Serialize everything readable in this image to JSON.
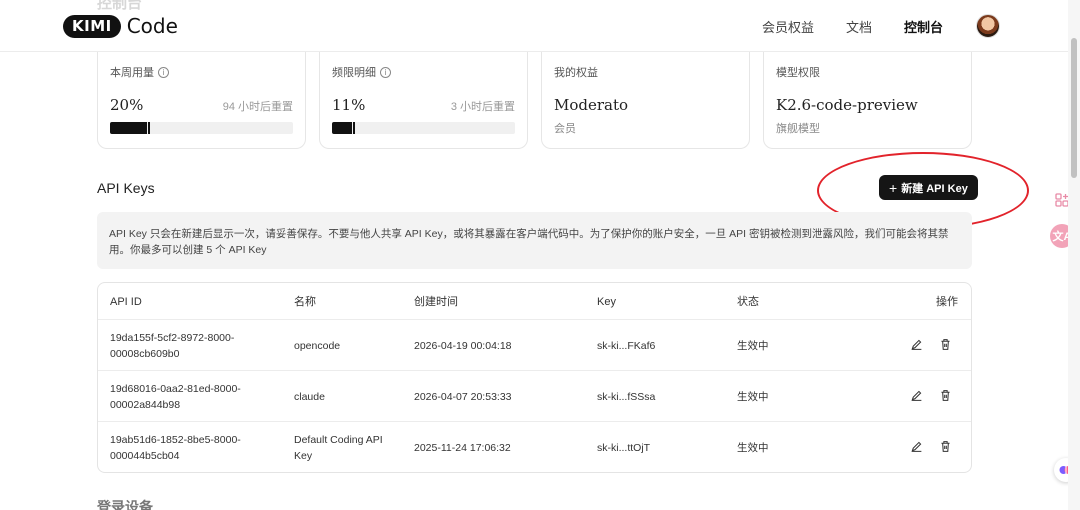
{
  "header": {
    "logo_badge": "KIMI",
    "logo_text": "Code",
    "nav": [
      "会员权益",
      "文档",
      "控制台"
    ],
    "active_nav": "控制台",
    "ghost_title": "控制台"
  },
  "cards": [
    {
      "label": "本周用量",
      "value": "20%",
      "reset": "94 小时后重置",
      "progress": 0.2
    },
    {
      "label": "频限明细",
      "value": "11%",
      "reset": "3 小时后重置",
      "progress": 0.11
    },
    {
      "label": "我的权益",
      "value": "Moderato",
      "sub": "会员"
    },
    {
      "label": "模型权限",
      "value": "K2.6-code-preview",
      "sub": "旗舰模型"
    }
  ],
  "api_keys": {
    "title": "API Keys",
    "new_button": "新建 API Key",
    "notice": "API Key 只会在新建后显示一次，请妥善保存。不要与他人共享 API Key，或将其暴露在客户端代码中。为了保护你的账户安全，一旦 API 密钥被检测到泄露风险，我们可能会将其禁用。你最多可以创建 5 个 API Key",
    "columns": [
      "API ID",
      "名称",
      "创建时间",
      "Key",
      "状态",
      "操作"
    ],
    "rows": [
      {
        "id": "19da155f-5cf2-8972-8000-00008cb609b0",
        "name": "opencode",
        "created": "2026-04-19 00:04:18",
        "key": "sk-ki...FKaf6",
        "status": "生效中"
      },
      {
        "id": "19d68016-0aa2-81ed-8000-00002a844b98",
        "name": "claude",
        "created": "2026-04-07 20:53:33",
        "key": "sk-ki...fSSsa",
        "status": "生效中"
      },
      {
        "id": "19ab51d6-1852-8be5-8000-000044b5cb04",
        "name": "Default Coding API Key",
        "created": "2025-11-24 17:06:32",
        "key": "sk-ki...ttOjT",
        "status": "生效中"
      }
    ]
  },
  "next_section_title": "登录设备",
  "colors": {
    "accent": "#151515",
    "highlight": "#e2232b",
    "notice_bg": "#f3f3f3"
  },
  "icons": [
    "info-icon",
    "plus-icon",
    "edit-icon",
    "trash-icon",
    "apps-icon",
    "translate-icon",
    "brain-icon"
  ]
}
